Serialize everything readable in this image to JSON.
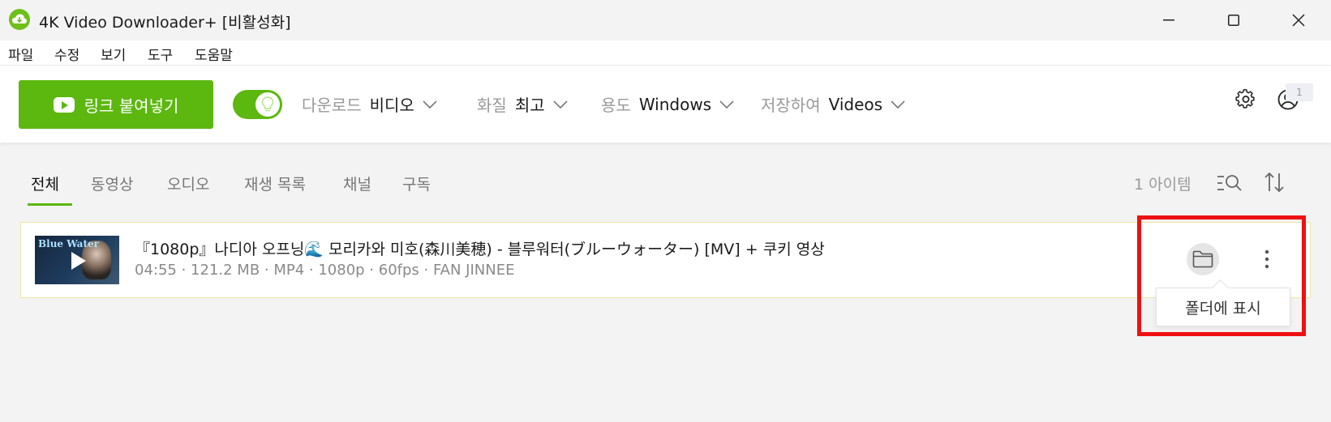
{
  "window": {
    "title": "4K Video Downloader+ [비활성화]",
    "minimize_icon": "minimize-icon",
    "maximize_icon": "maximize-icon",
    "close_icon": "close-icon"
  },
  "menu": {
    "items": [
      {
        "label": "파일"
      },
      {
        "label": "수정"
      },
      {
        "label": "보기"
      },
      {
        "label": "도구"
      },
      {
        "label": "도움말"
      }
    ]
  },
  "toolbar": {
    "paste_label": "링크 붙여넣기",
    "smart_mode_on": true,
    "download": {
      "label": "다운로드",
      "value": "비디오"
    },
    "quality": {
      "label": "화질",
      "value": "최고"
    },
    "purpose": {
      "label": "용도",
      "value": "Windows"
    },
    "save_to": {
      "label": "저장하여",
      "value": "Videos"
    },
    "notification_count": "1",
    "accent_color": "#5cb70f"
  },
  "tabs": [
    {
      "label": "전체",
      "active": true
    },
    {
      "label": "동영상"
    },
    {
      "label": "오디오"
    },
    {
      "label": "재생 목록"
    },
    {
      "label": "채널"
    },
    {
      "label": "구독"
    }
  ],
  "item_count": "1 아이템",
  "downloads": [
    {
      "thumbnail_text": "Blue Water",
      "title": "『1080p』나디아 오프닝🌊 모리카와 미호(森川美穂) - 블루워터(ブルーウォーター) [MV] + 쿠키 영상",
      "meta": "04:55 · 121.2 MB · MP4 · 1080p · 60fps · FAN JINNEE"
    }
  ],
  "tooltip": "폴더에 표시",
  "highlight_color": "#ee1111"
}
